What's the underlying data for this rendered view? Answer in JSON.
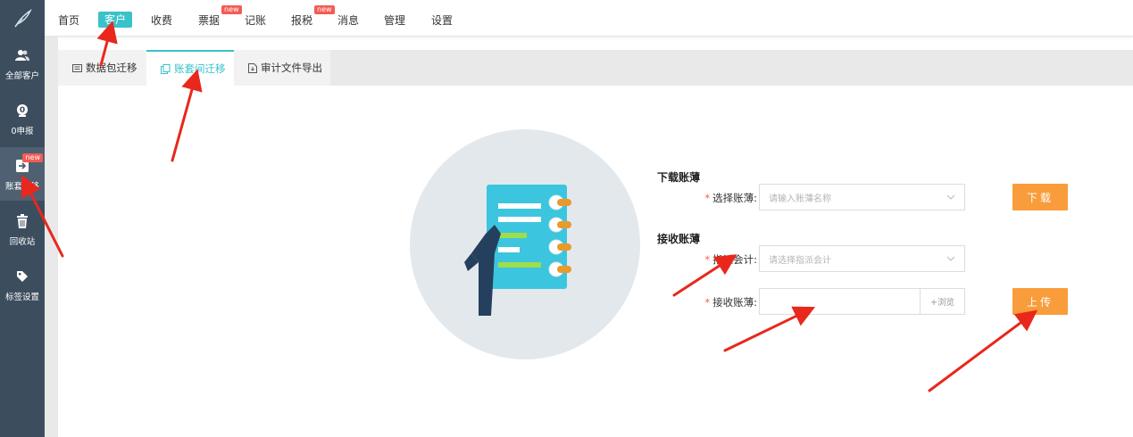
{
  "top_nav": {
    "items": [
      {
        "label": "首页",
        "active": false,
        "badge": ""
      },
      {
        "label": "客户",
        "active": true,
        "badge": ""
      },
      {
        "label": "收费",
        "active": false,
        "badge": ""
      },
      {
        "label": "票据",
        "active": false,
        "badge": "new"
      },
      {
        "label": "记账",
        "active": false,
        "badge": ""
      },
      {
        "label": "报税",
        "active": false,
        "badge": "new"
      },
      {
        "label": "消息",
        "active": false,
        "badge": ""
      },
      {
        "label": "管理",
        "active": false,
        "badge": ""
      },
      {
        "label": "设置",
        "active": false,
        "badge": ""
      }
    ]
  },
  "sidebar": {
    "items": [
      {
        "label": "全部客户",
        "icon": "users-icon",
        "active": false,
        "badge": ""
      },
      {
        "label": "0申报",
        "icon": "zero-declare-icon",
        "active": false,
        "badge": ""
      },
      {
        "label": "账套迁移",
        "icon": "migrate-icon",
        "active": true,
        "badge": "new"
      },
      {
        "label": "回收站",
        "icon": "trash-icon",
        "active": false,
        "badge": ""
      },
      {
        "label": "标签设置",
        "icon": "tag-icon",
        "active": false,
        "badge": ""
      }
    ]
  },
  "tabs": [
    {
      "label": "数据包迁移",
      "icon": "package-icon",
      "active": false
    },
    {
      "label": "账套间迁移",
      "icon": "copy-icon",
      "active": true
    },
    {
      "label": "审计文件导出",
      "icon": "export-file-icon",
      "active": false
    }
  ],
  "download_section": {
    "title": "下载账薄",
    "select_label": "选择账薄:",
    "select_placeholder": "请输入账薄名称",
    "button": "下载"
  },
  "receive_section": {
    "title": "接收账薄",
    "accountant_label": "指派会计:",
    "accountant_placeholder": "请选择指派会计",
    "file_label": "接收账薄:",
    "file_value": "",
    "browse_label": "+浏览",
    "button": "上传"
  },
  "colors": {
    "sidebar_bg": "#3c4d5e",
    "accent": "#39c2c9",
    "button_orange": "#f99c3b",
    "badge_red": "#f25c54",
    "annotation_arrow": "#e8281c"
  }
}
